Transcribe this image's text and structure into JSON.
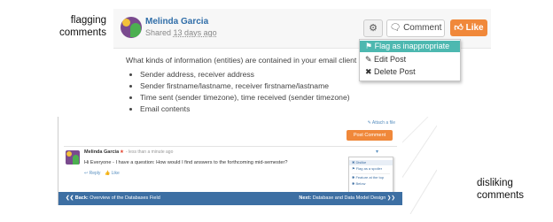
{
  "captions": {
    "flagging": "flagging comments",
    "disliking": "disliking comments"
  },
  "top_post": {
    "author": "Melinda Garcia",
    "shared_prefix": "Shared",
    "shared_time": "13 days ago",
    "buttons": {
      "gear_icon": "⚙",
      "comment": "Comment",
      "like": "Like"
    },
    "question": "What kinds of information (entities) are contained in your email client datab",
    "bullets": [
      "Sender address, receiver address",
      "Sender firstname/lastname, receiver firstname/lastname",
      "Time sent (sender timezone), time received (sender timezone)",
      "Email contents"
    ],
    "menu": {
      "flag": "Flag as inappropriate",
      "edit": "Edit Post",
      "delete": "Delete Post"
    }
  },
  "bottom_post": {
    "attach": "✎ Attach a file",
    "post_comment": "Post Comment",
    "author": "Melinda Garcia",
    "star": "★",
    "time": "- less than a minute ago",
    "text": "Hi Everyone - I have a question: How would I find answers to the forthcoming mid-semester?",
    "reply": "↩ Reply",
    "like": "👍 Like",
    "menu": {
      "dislike": "✖ Dislike",
      "flag": "⚑ Flag as a spoiler",
      "feature": "✱ Feature at the top",
      "below": "✱ Below"
    },
    "nav": {
      "back_prefix": "❮❮ Back:",
      "back_label": "Overview of the Databases Field",
      "next_prefix": "Next:",
      "next_label": "Database and Data Model Design ❯❯"
    }
  },
  "colors": {
    "accent_orange": "#f0883a",
    "flag_highlight": "#4db8b0",
    "nav_blue": "#3d6fa3",
    "link_blue": "#2f6da8"
  }
}
